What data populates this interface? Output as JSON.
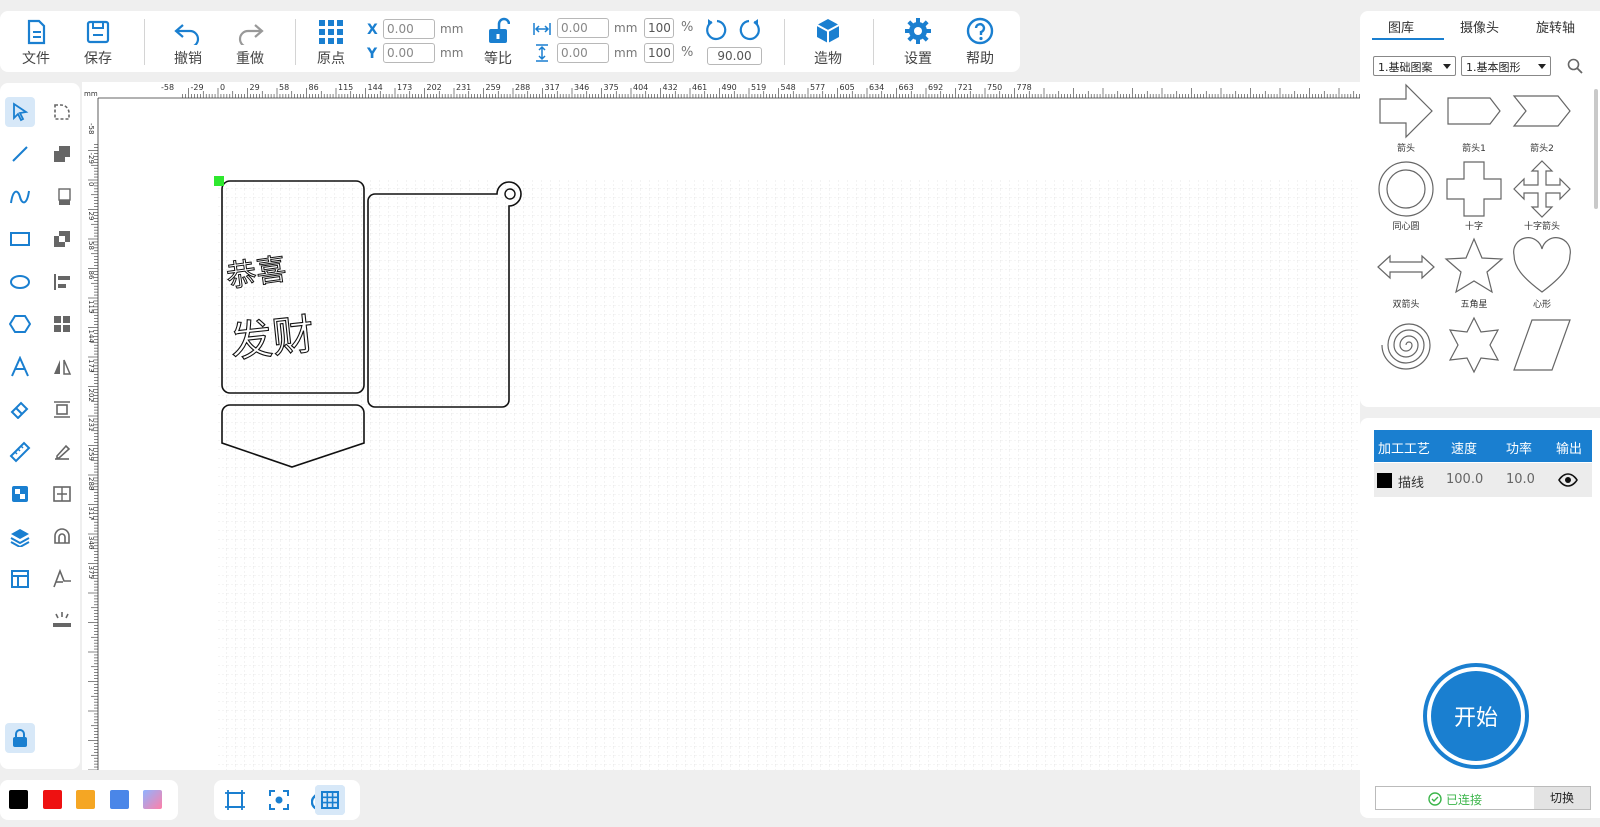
{
  "toolbar": {
    "file": "文件",
    "save": "保存",
    "undo": "撤销",
    "redo": "重做",
    "origin": "原点",
    "lock": "等比",
    "build": "造物",
    "settings": "设置",
    "help": "帮助",
    "x_label": "X",
    "y_label": "Y",
    "x_value": "0.00",
    "y_value": "0.00",
    "w_value": "0.00",
    "h_value": "0.00",
    "w_pct": "100",
    "h_pct": "100",
    "unit_mm": "mm",
    "pct": "%",
    "rotate": "90.00"
  },
  "ruler": {
    "unit": "mm",
    "h_ticks": [
      "-58",
      "-29",
      "0",
      "29",
      "58",
      "86",
      "115",
      "144",
      "173",
      "202",
      "231",
      "259",
      "288",
      "317",
      "346",
      "375",
      "404",
      "432",
      "461",
      "490",
      "519",
      "548",
      "577",
      "605",
      "634",
      "663",
      "692",
      "721",
      "750",
      "778"
    ],
    "v_ticks": [
      "-58",
      "-29",
      "0",
      "29",
      "58",
      "86",
      "115",
      "144",
      "173",
      "202",
      "231",
      "259",
      "288",
      "317",
      "346",
      "375"
    ]
  },
  "canvas": {
    "text_line1": "恭喜",
    "text_line2": "发财"
  },
  "palette": [
    "#000000",
    "#ee1111",
    "#f5a623",
    "#4a86e8",
    "gradient"
  ],
  "gallery": {
    "tabs": [
      "图库",
      "摄像头",
      "旋转轴"
    ],
    "active_tab": "图库",
    "select1": "1.基础图案",
    "select2": "1.基本图形",
    "shapes": [
      {
        "label": "箭头",
        "icon": "arrow-icon"
      },
      {
        "label": "箭头1",
        "icon": "arrow1-icon"
      },
      {
        "label": "箭头2",
        "icon": "arrow2-icon"
      },
      {
        "label": "同心圆",
        "icon": "concentric-circle-icon"
      },
      {
        "label": "十字",
        "icon": "cross-icon"
      },
      {
        "label": "十字箭头",
        "icon": "cross-arrow-icon"
      },
      {
        "label": "双箭头",
        "icon": "double-arrow-icon"
      },
      {
        "label": "五角星",
        "icon": "star-icon"
      },
      {
        "label": "心形",
        "icon": "heart-icon"
      },
      {
        "label": "",
        "icon": "spiral-icon"
      },
      {
        "label": "",
        "icon": "six-star-icon"
      },
      {
        "label": "",
        "icon": "parallelogram-icon"
      }
    ]
  },
  "process": {
    "headers": [
      "加工工艺",
      "速度",
      "功率",
      "输出"
    ],
    "rows": [
      {
        "mode": "描线",
        "speed": "100.0",
        "power": "10.0",
        "color": "#000000"
      }
    ]
  },
  "start_label": "开始",
  "connection": {
    "status": "已连接",
    "switch": "切换",
    "status_color": "#3bb54a"
  },
  "accent": "#1a7fd0"
}
